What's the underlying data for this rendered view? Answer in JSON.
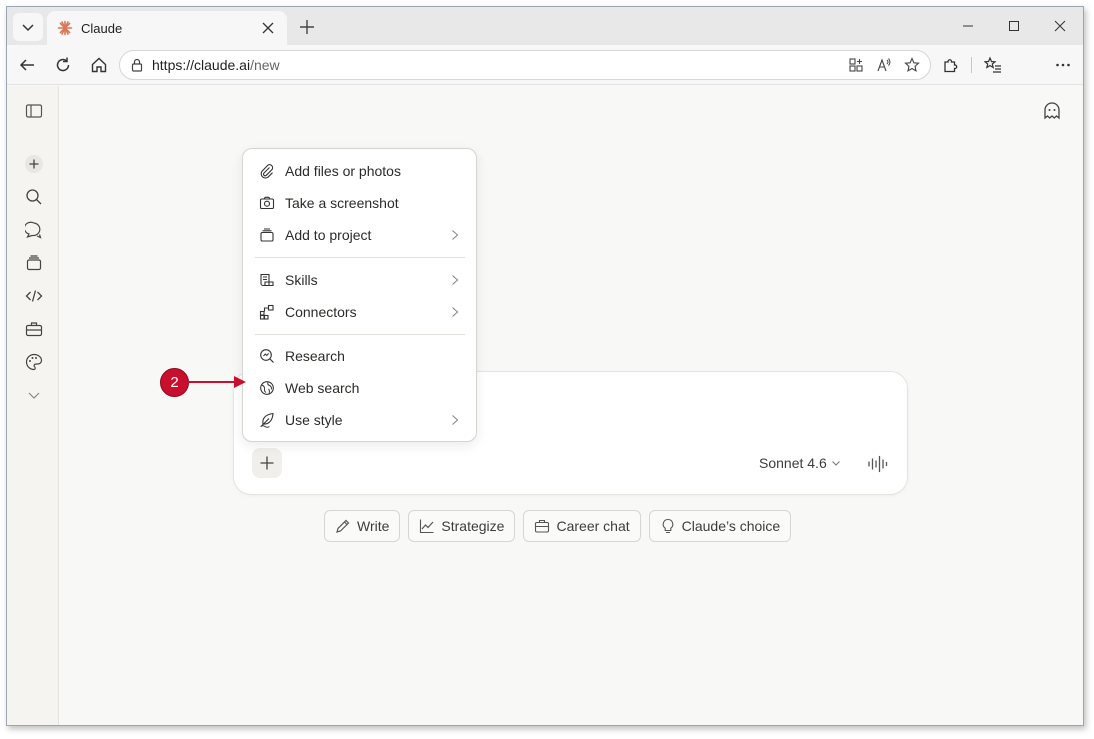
{
  "browser": {
    "tab_title": "Claude",
    "url_host": "https://claude.ai",
    "url_path": "/new"
  },
  "menu": {
    "items": [
      {
        "label": "Add files or photos",
        "icon": "paperclip-icon",
        "submenu": false
      },
      {
        "label": "Take a screenshot",
        "icon": "camera-icon",
        "submenu": false
      },
      {
        "label": "Add to project",
        "icon": "project-icon",
        "submenu": true
      },
      {
        "label": "Skills",
        "icon": "skills-icon",
        "submenu": true
      },
      {
        "label": "Connectors",
        "icon": "connectors-icon",
        "submenu": true
      },
      {
        "label": "Research",
        "icon": "research-icon",
        "submenu": false
      },
      {
        "label": "Web search",
        "icon": "globe-icon",
        "submenu": false
      },
      {
        "label": "Use style",
        "icon": "feather-icon",
        "submenu": true
      }
    ]
  },
  "composer": {
    "model": "Sonnet 4.6"
  },
  "chips": [
    {
      "label": "Write",
      "icon": "pencil-icon"
    },
    {
      "label": "Strategize",
      "icon": "chart-icon"
    },
    {
      "label": "Career chat",
      "icon": "briefcase-icon"
    },
    {
      "label": "Claude’s choice",
      "icon": "lightbulb-icon"
    }
  ],
  "annotation": {
    "step": "2",
    "color": "#c8102e"
  },
  "colors": {
    "accent": "#d97757",
    "page_bg": "#f8f8f6"
  }
}
